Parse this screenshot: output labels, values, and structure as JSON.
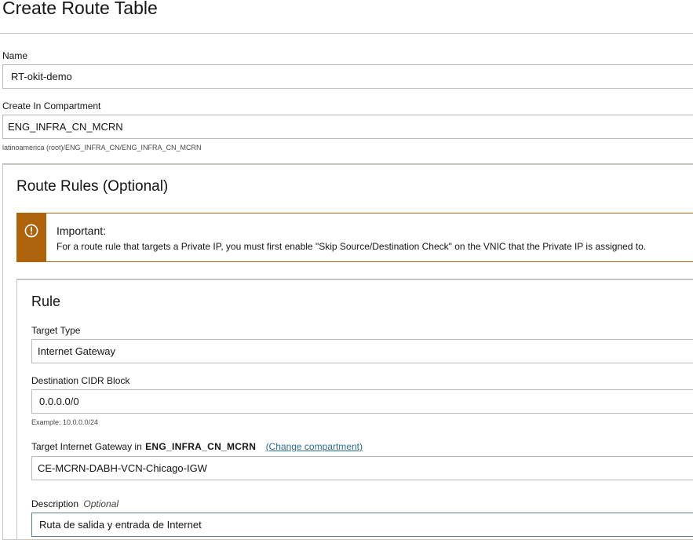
{
  "page": {
    "title": "Create Route Table"
  },
  "form": {
    "name_label": "Name",
    "name_value": "RT-okit-demo",
    "compartment_label": "Create In Compartment",
    "compartment_value": "ENG_INFRA_CN_MCRN",
    "compartment_path": "latinoamerica (root)/ENG_INFRA_CN/ENG_INFRA_CN_MCRN"
  },
  "route_rules": {
    "title": "Route Rules (Optional)",
    "alert": {
      "icon": "exclamation-circle-icon",
      "color": "#ac630c",
      "heading": "Important:",
      "body": "For a route rule that targets a Private IP, you must first enable \"Skip Source/Destination Check\" on the VNIC that the Private IP is assigned to."
    },
    "rule": {
      "title": "Rule",
      "target_type_label": "Target Type",
      "target_type_value": "Internet Gateway",
      "destination_label": "Destination CIDR Block",
      "destination_value": "0.0.0.0/0",
      "destination_example": "Example: 10.0.0.0/24",
      "gateway_label_prefix": "Target Internet Gateway in",
      "gateway_compartment": "ENG_INFRA_CN_MCRN",
      "change_compartment_link": "(Change compartment)",
      "gateway_value": "CE-MCRN-DABH-VCN-Chicago-IGW",
      "description_label": "Description",
      "description_optional": "Optional",
      "description_value": "Ruta de salida y entrada de Internet"
    }
  }
}
